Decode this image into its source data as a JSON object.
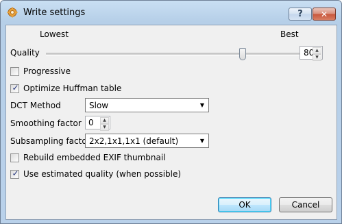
{
  "window": {
    "title": "Write settings",
    "help_glyph": "?",
    "close_glyph": "✕"
  },
  "quality": {
    "label": "Quality",
    "min_label": "Lowest",
    "max_label": "Best",
    "value": "80",
    "slider_level_percent": 80
  },
  "options": {
    "progressive": {
      "label": "Progressive",
      "checked": false
    },
    "optimize_huffman": {
      "label": "Optimize Huffman table",
      "checked": true
    },
    "rebuild_exif": {
      "label": "Rebuild embedded EXIF thumbnail",
      "checked": false
    },
    "estimated_quality": {
      "label": "Use estimated quality (when possible)",
      "checked": true
    }
  },
  "dct": {
    "label": "DCT Method",
    "value": "Slow"
  },
  "smoothing": {
    "label": "Smoothing factor",
    "value": "0"
  },
  "subsampling": {
    "label": "Subsampling factor",
    "value": "2x2,1x1,1x1 (default)"
  },
  "buttons": {
    "ok": "OK",
    "cancel": "Cancel"
  },
  "glyphs": {
    "check": "✓",
    "spin_up": "▲",
    "spin_down": "▼",
    "dropdown": "▼"
  }
}
